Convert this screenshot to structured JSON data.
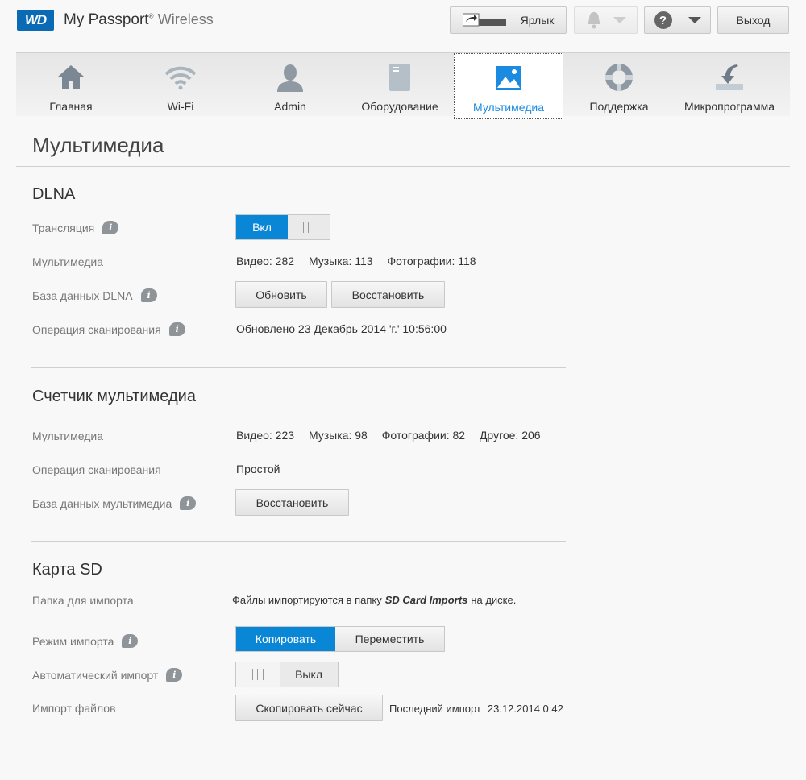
{
  "header": {
    "logo_text": "WD",
    "brand_main": "My Passport",
    "brand_reg": "®",
    "brand_sub": "Wireless",
    "shortcut_label": "Ярлык",
    "help_icon_text": "?",
    "logout_label": "Выход"
  },
  "nav": {
    "items": [
      {
        "label": "Главная"
      },
      {
        "label": "Wi-Fi"
      },
      {
        "label": "Admin"
      },
      {
        "label": "Оборудование"
      },
      {
        "label": "Мультимедиа"
      },
      {
        "label": "Поддержка"
      },
      {
        "label": "Микропрограмма"
      }
    ]
  },
  "page": {
    "title": "Мультимедиа"
  },
  "info_icon_text": "i",
  "dlna": {
    "title": "DLNA",
    "streaming_label": "Трансляция",
    "streaming_on": "Вкл",
    "media_label": "Мультимедиа",
    "video": "Видео: 282",
    "music": "Музыка: 113",
    "photos": "Фотографии: 118",
    "db_label": "База данных DLNA",
    "refresh_button": "Обновить",
    "restore_button": "Восстановить",
    "scan_label": "Операция сканирования",
    "scan_value": "Обновлено 23 Декабрь 2014 'г.' 10:56:00"
  },
  "media_counter": {
    "title": "Счетчик мультимедиа",
    "media_label": "Мультимедиа",
    "video": "Видео: 223",
    "music": "Музыка: 98",
    "photos": "Фотографии: 82",
    "other": "Другое: 206",
    "scan_label": "Операция сканирования",
    "scan_value": "Простой",
    "db_label": "База данных мультимедиа",
    "restore_button": "Восстановить"
  },
  "sd_card": {
    "title": "Карта SD",
    "folder_label": "Папка для импорта",
    "folder_text_before": "Файлы импортируются в папку",
    "folder_name": "SD Card Imports",
    "folder_text_after": "на диске.",
    "mode_label": "Режим импорта",
    "mode_copy": "Копировать",
    "mode_move": "Переместить",
    "auto_label": "Автоматический импорт",
    "auto_off": "Выкл",
    "import_label": "Импорт файлов",
    "copy_now_button": "Скопировать сейчас",
    "last_import_label": "Последний импорт",
    "last_import_value": "23.12.2014 0:42"
  }
}
